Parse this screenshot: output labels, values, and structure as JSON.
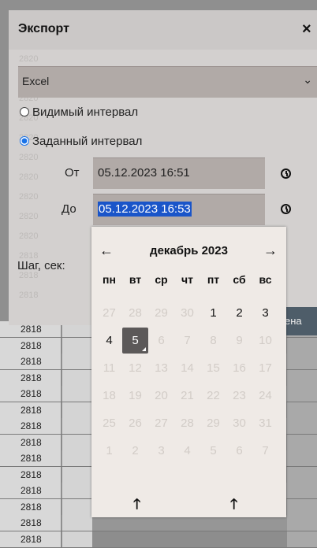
{
  "bg_rows": [
    "2818",
    "2818",
    "2818",
    "2818",
    "2818",
    "2818",
    "2818",
    "2818",
    "2818",
    "2818",
    "2818",
    "2818",
    "2818",
    "2818"
  ],
  "dialog": {
    "title": "Экспорт",
    "close": "×",
    "format": "Excel",
    "radio_visible": "Видимый интервал",
    "radio_custom": "Заданный интервал",
    "from_label": "От",
    "from_value": "05.12.2023 16:51",
    "to_label": "До",
    "to_value": "05.12.2023 16:53",
    "step_label": "Шаг, сек:",
    "cancel_partial": "ена",
    "faint_numbers": [
      "2820",
      "2820",
      "2820",
      "2820",
      "2820",
      "2820",
      "2820",
      "2820",
      "2820",
      "2820",
      "2818",
      "2818",
      "2818"
    ]
  },
  "calendar": {
    "prev": "←",
    "next": "→",
    "title": "декабрь 2023",
    "weekdays": [
      "пн",
      "вт",
      "ср",
      "чт",
      "пт",
      "сб",
      "вс"
    ],
    "weeks": [
      [
        "27",
        "28",
        "29",
        "30",
        "1",
        "2",
        "3"
      ],
      [
        "4",
        "5",
        "6",
        "7",
        "8",
        "9",
        "10"
      ],
      [
        "11",
        "12",
        "13",
        "14",
        "15",
        "16",
        "17"
      ],
      [
        "18",
        "19",
        "20",
        "21",
        "22",
        "23",
        "24"
      ],
      [
        "25",
        "26",
        "27",
        "28",
        "29",
        "30",
        "31"
      ],
      [
        "1",
        "2",
        "3",
        "4",
        "5",
        "6",
        "7"
      ]
    ],
    "current_month_cells": [
      [
        0,
        4
      ],
      [
        0,
        5
      ],
      [
        0,
        6
      ],
      [
        1,
        0
      ],
      [
        1,
        1
      ]
    ],
    "selected_cell": [
      1,
      1
    ],
    "up_arrow": "🡑"
  }
}
